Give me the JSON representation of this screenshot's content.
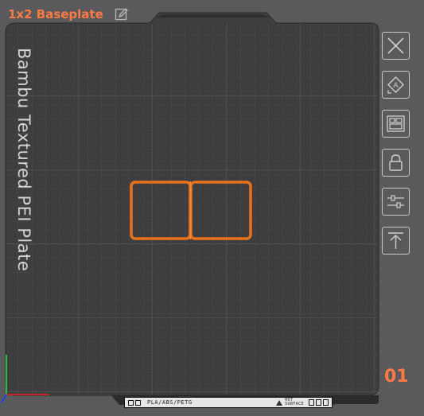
{
  "plate": {
    "title": "1x2 Baseplate",
    "number": "01",
    "bed_label": "Bambu Textured PEI Plate"
  },
  "footer": {
    "filaments": "PLA/ABS/PETG",
    "hot_line1": "HOT",
    "hot_line2": "SURFACE"
  },
  "toolbar": [
    {
      "icon": "close-icon"
    },
    {
      "icon": "auto-orient-icon"
    },
    {
      "icon": "arrange-icon"
    },
    {
      "icon": "lock-icon"
    },
    {
      "icon": "plate-settings-icon"
    },
    {
      "icon": "move-to-top-icon"
    }
  ],
  "colors": {
    "accent": "#ff7a45",
    "bed": "#3e3e40",
    "object_outline": "#e8731a",
    "grid": "#555559"
  }
}
